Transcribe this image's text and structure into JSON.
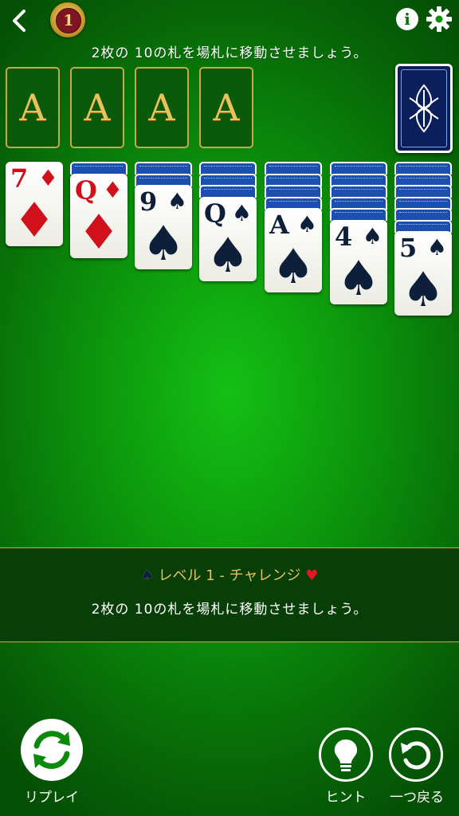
{
  "header": {
    "level_number": "1",
    "goal_text": "2枚の 10の札を場札に移動させましょう。",
    "info_label": "i"
  },
  "foundations": [
    {
      "label": "A"
    },
    {
      "label": "A"
    },
    {
      "label": "A"
    },
    {
      "label": "A"
    }
  ],
  "tableau": [
    {
      "face_down": 0,
      "rank": "7",
      "suit": "diamonds",
      "suit_symbol": "♦",
      "color": "red"
    },
    {
      "face_down": 1,
      "rank": "Q",
      "suit": "diamonds",
      "suit_symbol": "♦",
      "color": "red"
    },
    {
      "face_down": 2,
      "rank": "9",
      "suit": "spades",
      "suit_symbol": "♠",
      "color": "black"
    },
    {
      "face_down": 3,
      "rank": "Q",
      "suit": "spades",
      "suit_symbol": "♠",
      "color": "black"
    },
    {
      "face_down": 4,
      "rank": "A",
      "suit": "spades",
      "suit_symbol": "♠",
      "color": "black"
    },
    {
      "face_down": 5,
      "rank": "4",
      "suit": "spades",
      "suit_symbol": "♠",
      "color": "black"
    },
    {
      "face_down": 6,
      "rank": "5",
      "suit": "spades",
      "suit_symbol": "♠",
      "color": "black"
    }
  ],
  "panel": {
    "spade_symbol": "♠",
    "title": "レベル 1 - チャレンジ",
    "heart_symbol": "♥",
    "description": "2枚の 10の札を場札に移動させましょう。"
  },
  "controls": {
    "replay_label": "リプレイ",
    "hint_label": "ヒント",
    "undo_label": "一つ戻る"
  },
  "colors": {
    "table_green": "#0b8f0b",
    "gold": "#c9a74a",
    "card_back_blue": "#1c4fb0",
    "red_suit": "#d0101a",
    "black_suit": "#0e1f3a"
  }
}
